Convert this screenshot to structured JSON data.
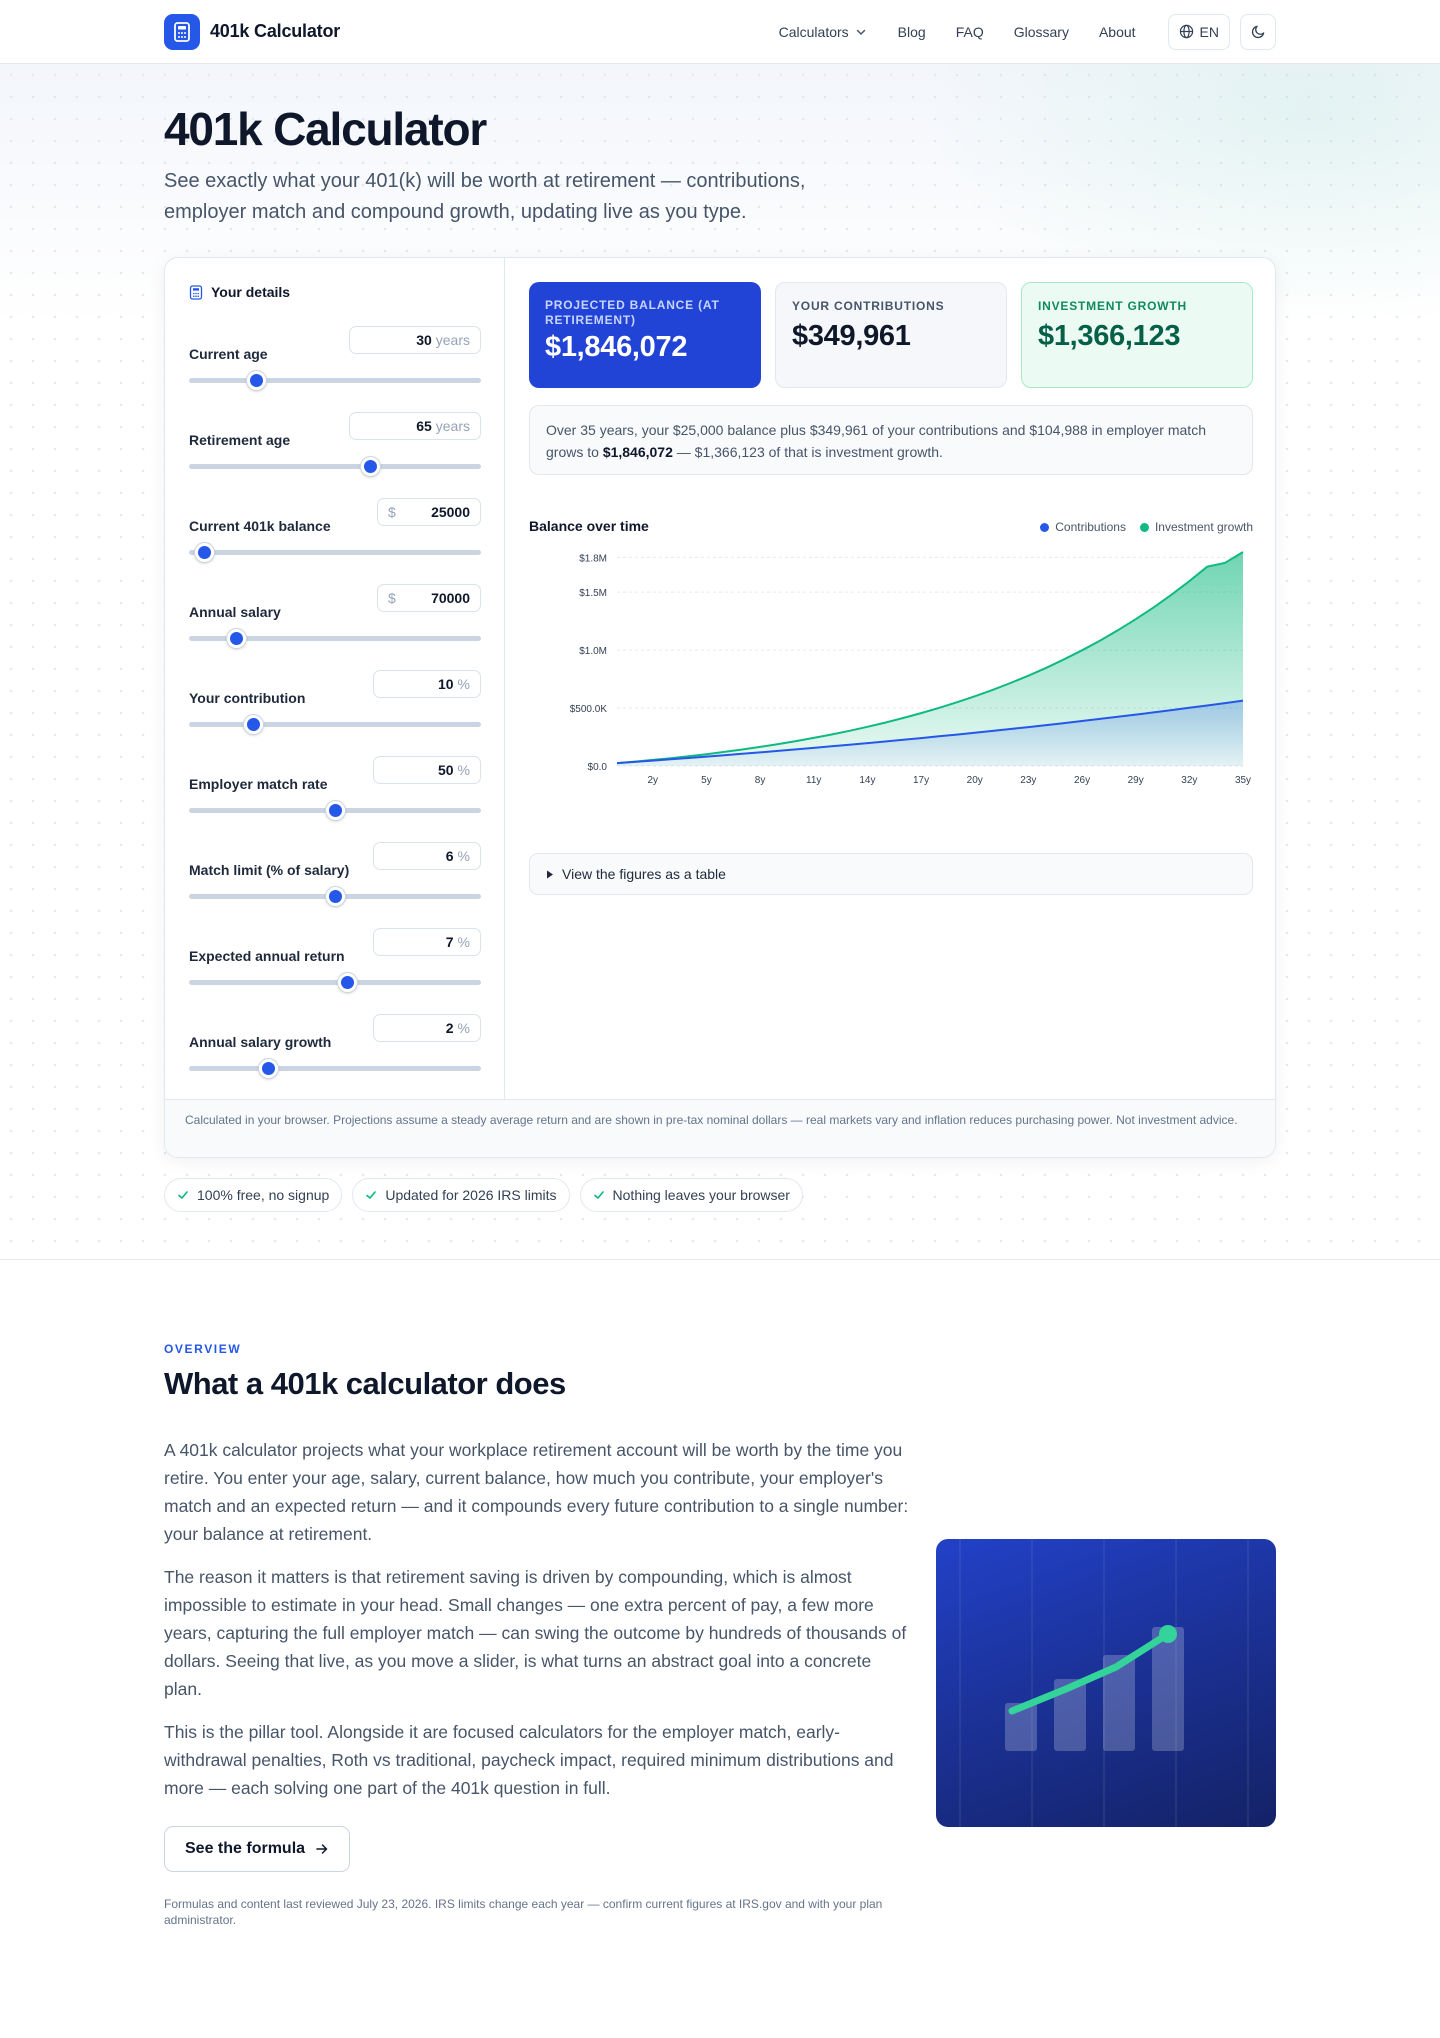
{
  "header": {
    "brand": "401k Calculator",
    "nav": [
      "Calculators",
      "Blog",
      "FAQ",
      "Glossary",
      "About"
    ],
    "lang": "EN"
  },
  "hero": {
    "title": "401k Calculator",
    "subtitle": "See exactly what your 401(k) will be worth at retirement — contributions, employer match and compound growth, updating live as you type."
  },
  "form": {
    "title": "Your details",
    "fields": [
      {
        "label": "Current age",
        "value": "30",
        "unit": "years",
        "prefix": "",
        "slider": 0.23
      },
      {
        "label": "Retirement age",
        "value": "65",
        "unit": "years",
        "prefix": "",
        "slider": 0.62
      },
      {
        "label": "Current 401k balance",
        "value": "25000",
        "unit": "",
        "prefix": "$",
        "slider": 0.05
      },
      {
        "label": "Annual salary",
        "value": "70000",
        "unit": "",
        "prefix": "$",
        "slider": 0.16
      },
      {
        "label": "Your contribution",
        "value": "10",
        "unit": "%",
        "prefix": "",
        "slider": 0.22
      },
      {
        "label": "Employer match rate",
        "value": "50",
        "unit": "%",
        "prefix": "",
        "slider": 0.5
      },
      {
        "label": "Match limit (% of salary)",
        "value": "6",
        "unit": "%",
        "prefix": "",
        "slider": 0.5
      },
      {
        "label": "Expected annual return",
        "value": "7",
        "unit": "%",
        "prefix": "",
        "slider": 0.54
      },
      {
        "label": "Annual salary growth",
        "value": "2",
        "unit": "%",
        "prefix": "",
        "slider": 0.27
      }
    ]
  },
  "results": {
    "projected_label": "Projected balance (at retirement)",
    "projected_value": "$1,846,072",
    "contrib_label": "Your contributions",
    "contrib_value": "$349,961",
    "growth_label": "Investment growth",
    "growth_value": "$1,366,123",
    "summary_pre": "Over 35 years, your $25,000 balance plus $349,961 of your contributions and $104,988 in employer match grows to ",
    "summary_bold": "$1,846,072",
    "summary_post": " — $1,366,123 of that is investment growth.",
    "details_label": "View the figures as a table",
    "footnote": "Calculated in your browser. Projections assume a steady average return and are shown in pre-tax nominal dollars — real markets vary and inflation reduces purchasing power. Not investment advice."
  },
  "chart_data": {
    "type": "area",
    "title": "Balance over time",
    "xlabel": "",
    "ylabel": "",
    "x": [
      0,
      1,
      2,
      3,
      4,
      5,
      6,
      7,
      8,
      9,
      10,
      11,
      12,
      13,
      14,
      15,
      16,
      17,
      18,
      19,
      20,
      21,
      22,
      23,
      24,
      25,
      26,
      27,
      28,
      29,
      30,
      31,
      32,
      33,
      34,
      35
    ],
    "x_tick_labels": [
      "2y",
      "5y",
      "8y",
      "11y",
      "14y",
      "17y",
      "20y",
      "23y",
      "26y",
      "29y",
      "32y",
      "35y"
    ],
    "x_ticks": [
      2,
      5,
      8,
      11,
      14,
      17,
      20,
      23,
      26,
      29,
      32,
      35
    ],
    "y_ticks": [
      0,
      500000,
      1000000,
      1500000,
      1800000
    ],
    "y_tick_labels": [
      "$0.0",
      "$500.0K",
      "$1.0M",
      "$1.5M",
      "$1.8M"
    ],
    "ylim": [
      0,
      1846072
    ],
    "series": [
      {
        "name": "Contributions",
        "color": "#2557e8",
        "values": [
          25000,
          35780,
          46776,
          57991,
          69431,
          81100,
          93002,
          105142,
          117525,
          130156,
          143039,
          156180,
          169584,
          183255,
          197200,
          211424,
          225932,
          240731,
          255826,
          271222,
          286926,
          302944,
          319283,
          335949,
          352948,
          370287,
          387972,
          406011,
          424411,
          443179,
          462322,
          481848,
          501764,
          522079,
          542800,
          563935
        ]
      },
      {
        "name": "Investment growth",
        "color": "#10b981",
        "values": [
          25000,
          38130,
          52341,
          67703,
          84291,
          102183,
          121465,
          142226,
          164563,
          188580,
          214384,
          242093,
          271832,
          303735,
          337945,
          374615,
          413912,
          456015,
          501114,
          549417,
          601144,
          656533,
          715836,
          779326,
          847295,
          920054,
          997933,
          1081285,
          1170487,
          1265941,
          1368078,
          1477357,
          1594265,
          1719327,
          1753000,
          1846072
        ]
      }
    ],
    "legend": "top-right",
    "grid": true
  },
  "trust": [
    "100% free, no signup",
    "Updated for 2026 IRS limits",
    "Nothing leaves your browser"
  ],
  "overview": {
    "eyebrow": "OVERVIEW",
    "title": "What a 401k calculator does",
    "p1": "A 401k calculator projects what your workplace retirement account will be worth by the time you retire. You enter your age, salary, current balance, how much you contribute, your employer's match and an expected return — and it compounds every future contribution to a single number: your balance at retirement.",
    "p2": "The reason it matters is that retirement saving is driven by compounding, which is almost impossible to estimate in your head. Small changes — one extra percent of pay, a few more years, capturing the full employer match — can swing the outcome by hundreds of thousands of dollars. Seeing that live, as you move a slider, is what turns an abstract goal into a concrete plan.",
    "p3": "This is the pillar tool. Alongside it are focused calculators for the employer match, early-withdrawal penalties, Roth vs traditional, paycheck impact, required minimum distributions and more — each solving one part of the 401k question in full.",
    "button": "See the formula",
    "reviewed": "Formulas and content last reviewed July 23, 2026. IRS limits change each year — confirm current figures at IRS.gov and with your plan administrator."
  }
}
